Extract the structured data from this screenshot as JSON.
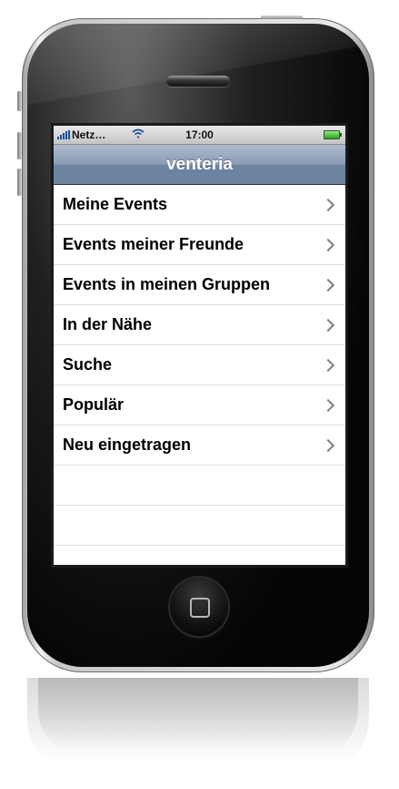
{
  "status_bar": {
    "carrier": "Netz…",
    "time": "17:00",
    "wifi_icon": "wifi-icon",
    "battery_icon": "battery-icon",
    "signal_icon": "signal-bars-icon"
  },
  "nav": {
    "title": "venteria"
  },
  "menu": {
    "items": [
      {
        "label": "Meine Events"
      },
      {
        "label": "Events meiner Freunde"
      },
      {
        "label": "Events in meinen Gruppen"
      },
      {
        "label": "In der Nähe"
      },
      {
        "label": "Suche"
      },
      {
        "label": "Populär"
      },
      {
        "label": "Neu eingetragen"
      }
    ],
    "chevron_icon": "chevron-right-icon"
  },
  "device": {
    "home_button_icon": "home-button-icon",
    "speaker_icon": "earpiece-speaker"
  },
  "colors": {
    "nav_bar": "#6d84a2",
    "chevron": "#7f7f7f",
    "battery": "#27a51a",
    "signal": "#1a4f9a"
  }
}
